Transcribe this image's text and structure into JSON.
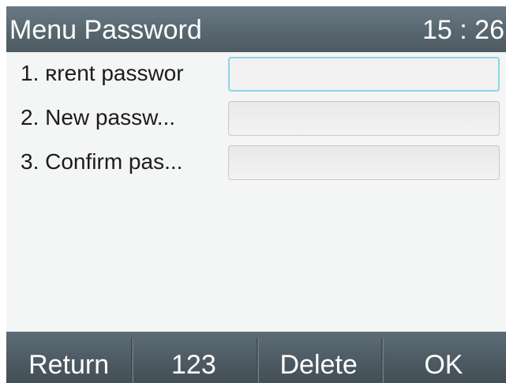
{
  "header": {
    "title": "Menu Password",
    "time": "15 : 26"
  },
  "fields": [
    {
      "label": "1. ʀrent passwor",
      "value": ""
    },
    {
      "label": "2. New passw...",
      "value": ""
    },
    {
      "label": "3. Confirm pas...",
      "value": ""
    }
  ],
  "softkeys": {
    "return_label": "Return",
    "input_mode_label": "123",
    "delete_label": "Delete",
    "ok_label": "OK"
  },
  "colors": {
    "header_bg": "#58666f",
    "softkey_bg": "#4f5c65",
    "focus_border": "#8fd4e6",
    "content_bg": "#f4f5f5"
  }
}
